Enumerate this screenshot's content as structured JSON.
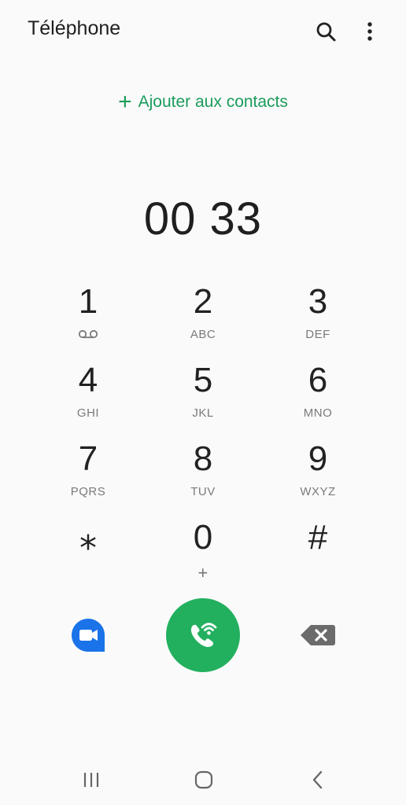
{
  "header": {
    "title": "Téléphone",
    "search_icon": "search-icon",
    "more_icon": "more-vertical-icon"
  },
  "add_contact": {
    "plus": "+",
    "label": "Ajouter aux contacts"
  },
  "display": {
    "number": "00 33"
  },
  "keypad": [
    {
      "digit": "1",
      "sub": "",
      "sub_icon": "voicemail-icon"
    },
    {
      "digit": "2",
      "sub": "ABC"
    },
    {
      "digit": "3",
      "sub": "DEF"
    },
    {
      "digit": "4",
      "sub": "GHI"
    },
    {
      "digit": "5",
      "sub": "JKL"
    },
    {
      "digit": "6",
      "sub": "MNO"
    },
    {
      "digit": "7",
      "sub": "PQRS"
    },
    {
      "digit": "8",
      "sub": "TUV"
    },
    {
      "digit": "9",
      "sub": "WXYZ"
    },
    {
      "digit": "⁎",
      "sub": ""
    },
    {
      "digit": "0",
      "sub": "+"
    },
    {
      "digit": "#",
      "sub": ""
    }
  ],
  "actions": {
    "video_icon": "video-call-icon",
    "call_icon": "wifi-call-icon",
    "backspace_icon": "backspace-icon"
  },
  "colors": {
    "accent": "#1a9c5b",
    "call_button": "#22b05f",
    "video_button": "#1a73e8",
    "background": "#fafafa"
  },
  "navbar": {
    "recent_icon": "recent-apps-icon",
    "home_icon": "home-icon",
    "back_icon": "back-icon"
  }
}
